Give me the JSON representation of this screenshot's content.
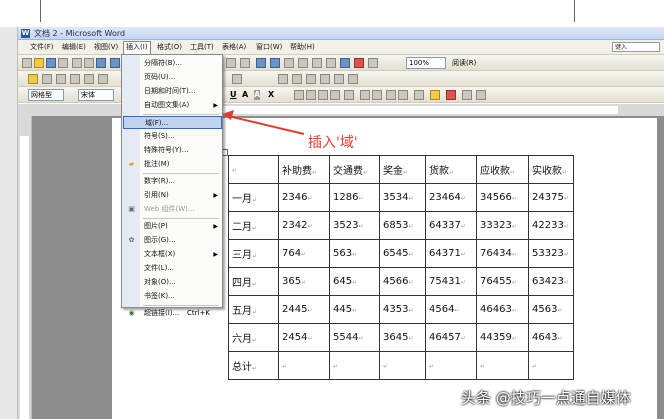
{
  "window": {
    "title": "文档 2 - Microsoft Word"
  },
  "menubar": {
    "items": [
      "文件(F)",
      "编辑(E)",
      "视图(V)",
      "插入(I)",
      "格式(O)",
      "工具(T)",
      "表格(A)",
      "窗口(W)",
      "帮助(H)"
    ],
    "active_index": 3,
    "help_box_placeholder": "键入"
  },
  "toolbar": {
    "zoom": "100%",
    "reading_mode": "阅读(R)",
    "style": "网格型",
    "font": "宋体",
    "format_buttons": [
      "U",
      "A",
      "A",
      "X"
    ]
  },
  "insert_menu": {
    "items": [
      {
        "label": "分隔符(B)...",
        "icon": "",
        "submenu": false,
        "enabled": true
      },
      {
        "label": "页码(U)...",
        "icon": "",
        "submenu": false,
        "enabled": true
      },
      {
        "label": "日期和时间(T)...",
        "icon": "",
        "submenu": false,
        "enabled": true
      },
      {
        "label": "自动图文集(A)",
        "icon": "",
        "submenu": true,
        "enabled": true
      },
      {
        "label": "域(F)...",
        "icon": "",
        "submenu": false,
        "enabled": true,
        "highlighted": true
      },
      {
        "label": "符号(S)...",
        "icon": "",
        "submenu": false,
        "enabled": true
      },
      {
        "label": "特殊符号(Y)...",
        "icon": "",
        "submenu": false,
        "enabled": true
      },
      {
        "label": "批注(M)",
        "icon": "comment-icon",
        "submenu": false,
        "enabled": true
      },
      {
        "label": "数字(R)...",
        "icon": "",
        "submenu": false,
        "enabled": true
      },
      {
        "label": "引用(N)",
        "icon": "",
        "submenu": true,
        "enabled": true
      },
      {
        "label": "Web 组件(W)...",
        "icon": "web-component-icon",
        "submenu": false,
        "enabled": false
      },
      {
        "label": "图片(P)",
        "icon": "",
        "submenu": true,
        "enabled": true
      },
      {
        "label": "图示(G)...",
        "icon": "diagram-icon",
        "submenu": false,
        "enabled": true
      },
      {
        "label": "文本框(X)",
        "icon": "",
        "submenu": true,
        "enabled": true
      },
      {
        "label": "文件(L)...",
        "icon": "",
        "submenu": false,
        "enabled": true
      },
      {
        "label": "对象(O)...",
        "icon": "",
        "submenu": false,
        "enabled": true
      },
      {
        "label": "书签(K)...",
        "icon": "",
        "submenu": false,
        "enabled": true
      },
      {
        "label": "超链接(I)...",
        "icon": "hyperlink-icon",
        "shortcut": "Ctrl+K",
        "submenu": false,
        "enabled": true
      }
    ]
  },
  "annotation": {
    "text": "插入'域'",
    "color": "#e03c31"
  },
  "table": {
    "headers": [
      "",
      "补助费",
      "交通费",
      "奖金",
      "货款",
      "应收款",
      "实收款"
    ],
    "rows": [
      [
        "一月",
        "2346",
        "1286",
        "3534",
        "23464",
        "34566",
        "24375"
      ],
      [
        "二月",
        "2342",
        "3523",
        "6853",
        "64337",
        "33323",
        "42233"
      ],
      [
        "三月",
        "764",
        "563",
        "6545",
        "64371",
        "76434",
        "53323"
      ],
      [
        "四月",
        "365",
        "645",
        "4566",
        "75431",
        "76455",
        "63423"
      ],
      [
        "五月",
        "2445",
        "445",
        "4353",
        "4564",
        "46463",
        "4563"
      ],
      [
        "六月",
        "2454",
        "5544",
        "3645",
        "46457",
        "44359",
        "4643"
      ],
      [
        "总计",
        "",
        "",
        "",
        "",
        "",
        ""
      ]
    ]
  },
  "watermark": "头条 @技巧一点通自媒体"
}
